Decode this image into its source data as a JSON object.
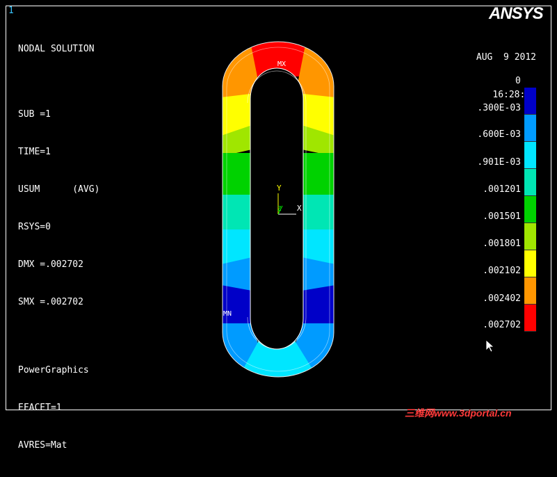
{
  "window_number": "1",
  "logo": "ANSYS",
  "info_lines": [
    "NODAL SOLUTION",
    "",
    "SUB =1",
    "TIME=1",
    "USUM      (AVG)",
    "RSYS=0",
    "DMX =.002702",
    "SMX =.002702",
    "",
    "PowerGraphics",
    "EFACET=1",
    "AVRES=Mat"
  ],
  "date": "AUG  9 2012",
  "time": "16:28:03",
  "legend": {
    "top_value": "0",
    "labels": [
      ".300E-03",
      ".600E-03",
      ".901E-03",
      ".001201",
      ".001501",
      ".001801",
      ".002102",
      ".002402",
      ".002702"
    ],
    "colors": [
      "#0000c8",
      "#009bff",
      "#00e6ff",
      "#00e6b4",
      "#00d200",
      "#a0e600",
      "#ffff00",
      "#ff9600",
      "#ff0000"
    ]
  },
  "markers": {
    "max": "MX",
    "min": "MN"
  },
  "triad": {
    "y": "Y",
    "x": "X",
    "z": "Z"
  },
  "watermark": "三维网www.3dportal.cn"
}
